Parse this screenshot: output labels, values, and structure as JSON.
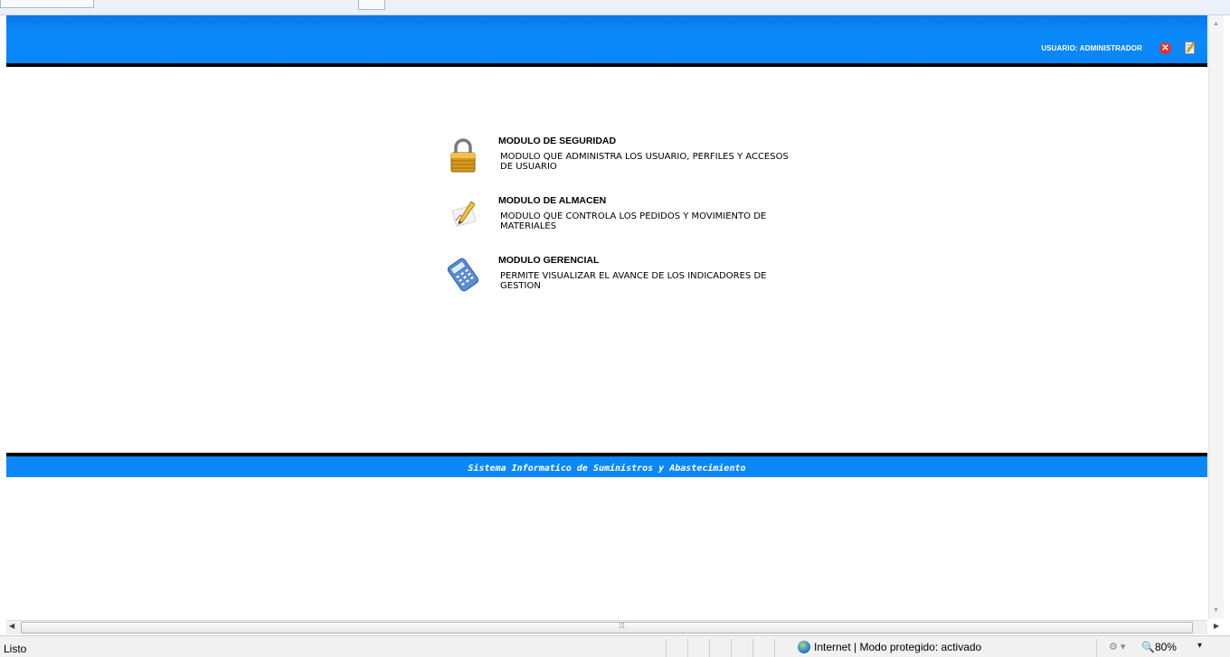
{
  "header": {
    "user_label": "USUARIO: ADMINISTRADOR",
    "close_icon": "close-icon",
    "edit_icon": "edit-icon"
  },
  "modules": [
    {
      "icon": "lock-icon",
      "title": "MODULO DE SEGURIDAD",
      "description": "MODULO QUE ADMINISTRA LOS USUARIO, PERFILES Y ACCESOS DE USUARIO"
    },
    {
      "icon": "pencil-chart-icon",
      "title": "MODULO DE ALMACEN",
      "description": "MODULO QUE CONTROLA LOS PEDIDOS Y MOVIMIENTO DE MATERIALES"
    },
    {
      "icon": "calculator-icon",
      "title": "MODULO GERENCIAL",
      "description": "PERMITE VISUALIZAR EL AVANCE DE LOS INDICADORES DE GESTION"
    }
  ],
  "footer": {
    "text": "Sistema Informatico de Suministros y Abastecimiento"
  },
  "statusbar": {
    "status": "Listo",
    "zone": "Internet | Modo protegido: activado",
    "zoom": "80%"
  },
  "colors": {
    "header_blue": "#0b87f8",
    "rule_black": "#000000"
  }
}
